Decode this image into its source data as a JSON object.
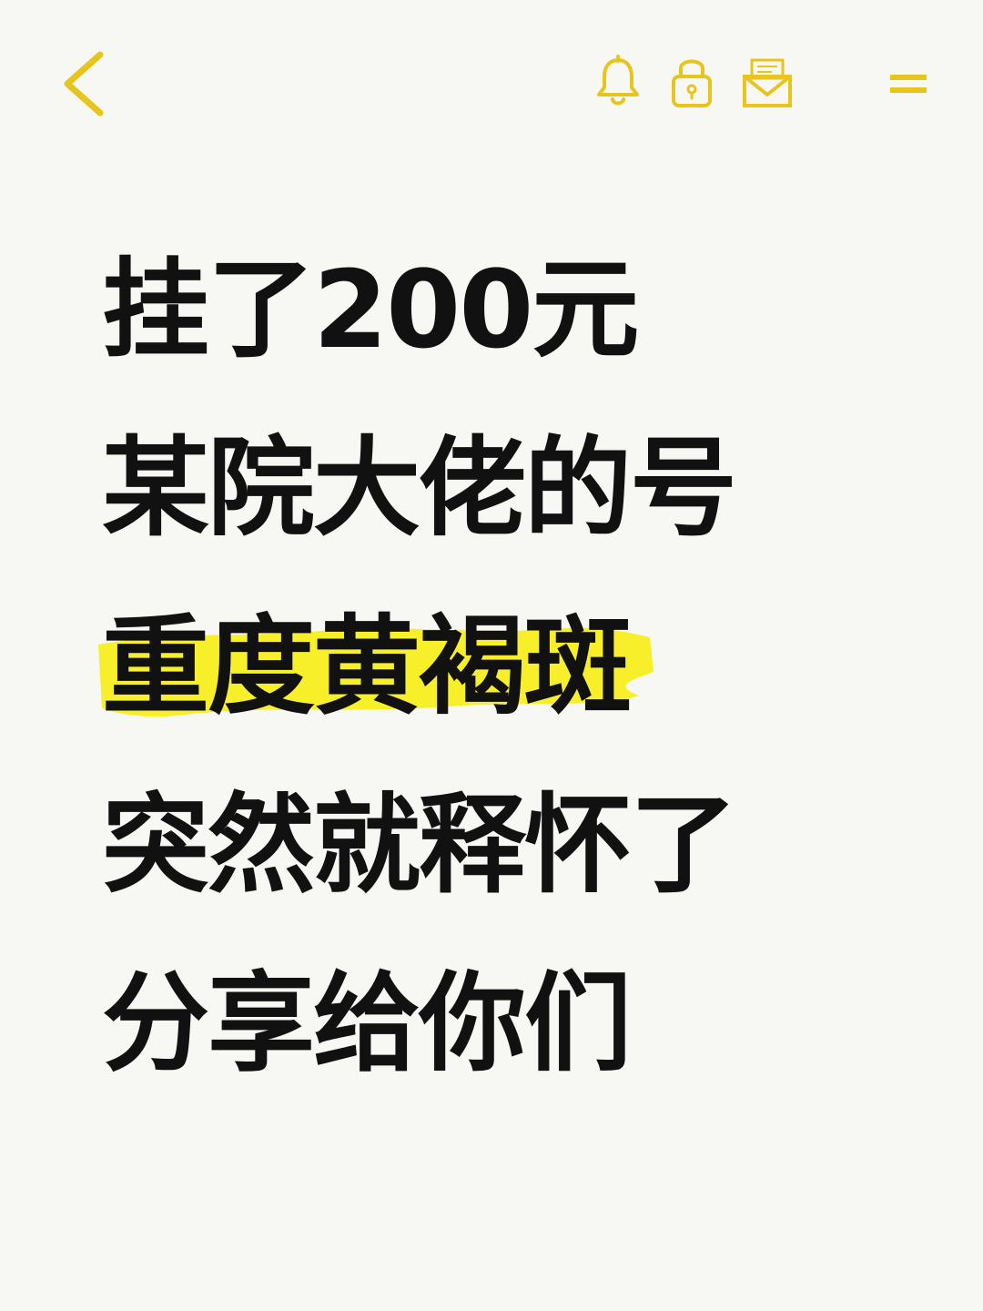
{
  "toolbar": {
    "icons": [
      "chevron-left-icon",
      "bell-icon",
      "lock-icon",
      "mail-icon",
      "menu-icon"
    ],
    "accent_color": "#e8c51c"
  },
  "content": {
    "lines": [
      {
        "text": "挂了200元"
      },
      {
        "text": "某院大佬的号"
      },
      {
        "text": "重度黄褐斑",
        "highlight_color": "#f6ef2a"
      },
      {
        "text": "突然就释怀了"
      },
      {
        "text": "分享给你们"
      }
    ]
  }
}
